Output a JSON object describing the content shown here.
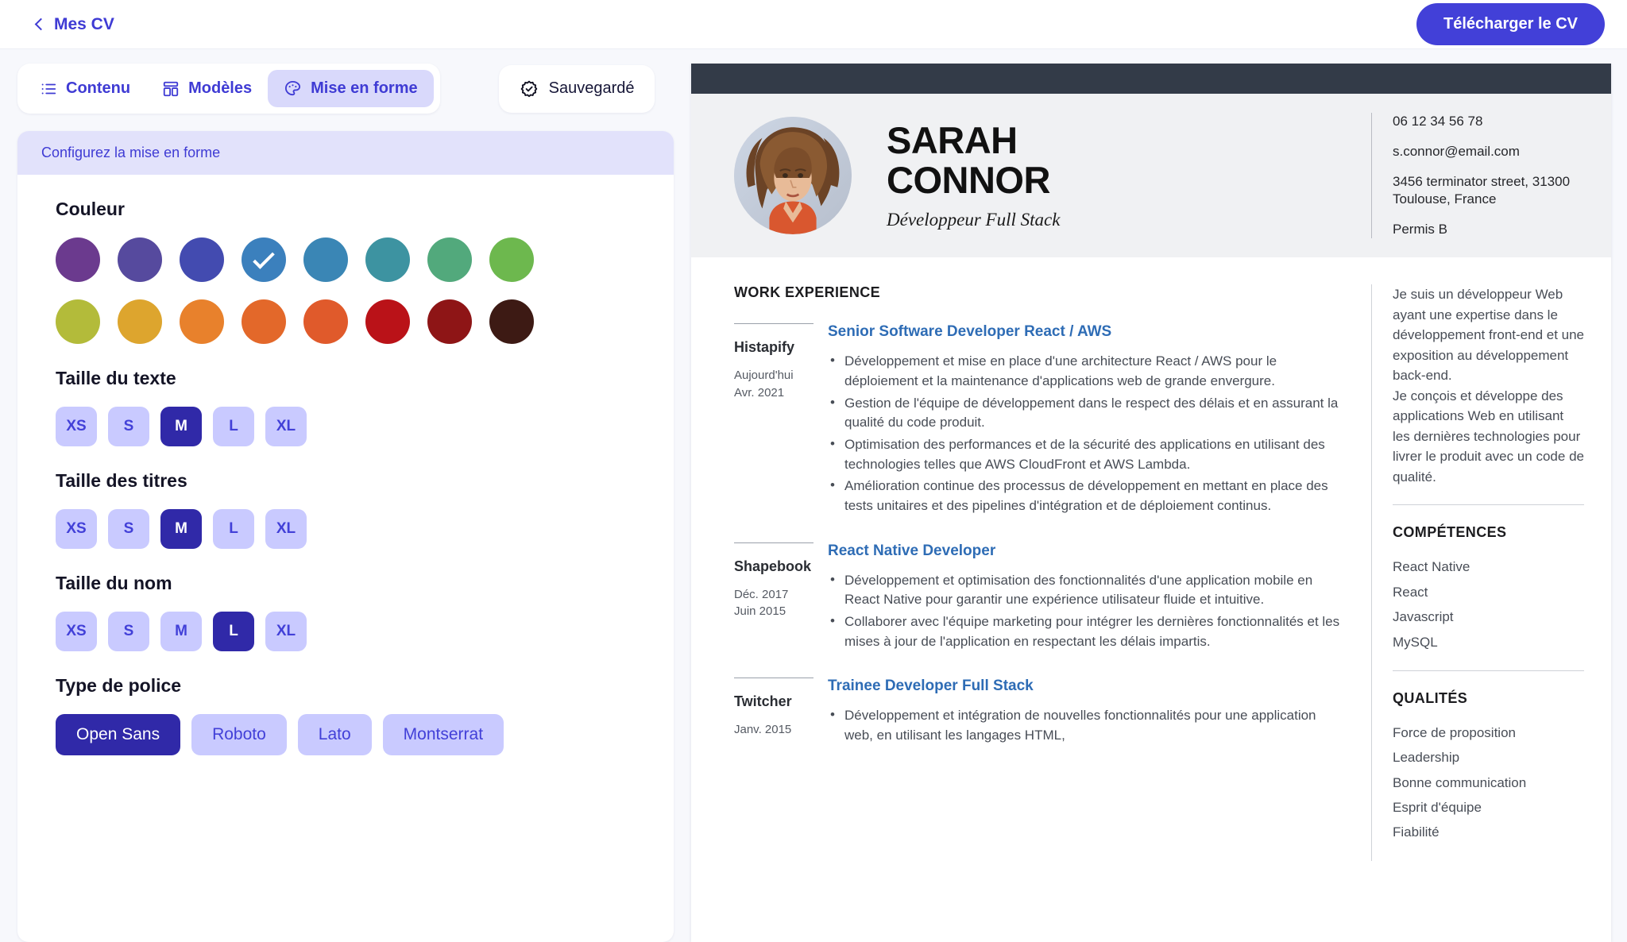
{
  "topbar": {
    "back_label": "Mes CV",
    "back_icon": "chevron-left-icon",
    "download_label": "Télécharger le CV"
  },
  "tabs": [
    {
      "label": "Contenu",
      "icon": "list-icon",
      "active": false
    },
    {
      "label": "Modèles",
      "icon": "layout-icon",
      "active": false
    },
    {
      "label": "Mise en forme",
      "icon": "palette-icon",
      "active": true
    }
  ],
  "save_status": {
    "label": "Sauvegardé",
    "icon": "badge-check-icon"
  },
  "panel": {
    "header": "Configurez la mise en forme",
    "color": {
      "title": "Couleur",
      "selected_index": 3,
      "swatches": [
        "#6b3a8e",
        "#564a9e",
        "#434bb0",
        "#3b80bd",
        "#3a86b5",
        "#3d93a1",
        "#52a97c",
        "#6db84e",
        "#b3bb3a",
        "#dda52e",
        "#e8812c",
        "#e3682a",
        "#e05a2b",
        "#ba1218",
        "#8e1516",
        "#3d1a14"
      ]
    },
    "text_size": {
      "title": "Taille du texte",
      "options": [
        "XS",
        "S",
        "M",
        "L",
        "XL"
      ],
      "selected": "M"
    },
    "heading_size": {
      "title": "Taille des titres",
      "options": [
        "XS",
        "S",
        "M",
        "L",
        "XL"
      ],
      "selected": "M"
    },
    "name_size": {
      "title": "Taille du nom",
      "options": [
        "XS",
        "S",
        "M",
        "L",
        "XL"
      ],
      "selected": "L"
    },
    "font_type": {
      "title": "Type de police",
      "options": [
        "Open Sans",
        "Roboto",
        "Lato",
        "Montserrat"
      ],
      "selected": "Open Sans"
    }
  },
  "cv": {
    "name_line1": "SARAH",
    "name_line2": "CONNOR",
    "role": "Développeur Full Stack",
    "avatar_alt": "profile-photo",
    "contact": [
      "06 12 34 56 78",
      "s.connor@email.com",
      "3456 terminator street, 31300 Toulouse, France",
      "Permis B"
    ],
    "experience_title": "WORK EXPERIENCE",
    "jobs": [
      {
        "company": "Histapify",
        "date_end": "Aujourd'hui",
        "date_start": "Avr. 2021",
        "title": "Senior Software Developer React / AWS",
        "bullets": [
          "Développement et mise en place d'une architecture React / AWS pour le déploiement et la maintenance d'applications web de grande envergure.",
          "Gestion de l'équipe de développement dans le respect des délais et en assurant la qualité du code produit.",
          "Optimisation des performances et de la sécurité des applications en utilisant des technologies telles que AWS CloudFront et AWS Lambda.",
          "Amélioration continue des processus de développement en mettant en place des tests unitaires et des pipelines d'intégration et de déploiement continus."
        ]
      },
      {
        "company": "Shapebook",
        "date_end": "Déc. 2017",
        "date_start": "Juin 2015",
        "title": "React Native Developer",
        "bullets": [
          "Développement et optimisation des fonctionnalités d'une application mobile en React Native pour garantir une expérience utilisateur fluide et intuitive.",
          "Collaborer avec l'équipe marketing pour intégrer les dernières fonctionnalités et les mises à jour de l'application en respectant les délais impartis."
        ]
      },
      {
        "company": "Twitcher",
        "date_end": "Janv. 2015",
        "date_start": "",
        "title": "Trainee Developer Full Stack",
        "bullets": [
          "Développement et intégration de nouvelles fonctionnalités pour une application web, en utilisant les langages HTML,"
        ]
      }
    ],
    "summary": "Je suis un développeur Web ayant une expertise dans le développement front-end et une exposition au développement back-end.\nJe conçois et développe des applications Web en utilisant les dernières technologies pour livrer le produit avec un code de qualité.",
    "skills_title": "COMPÉTENCES",
    "skills": [
      "React Native",
      "React",
      "Javascript",
      "MySQL"
    ],
    "qualities_title": "QUALITÉS",
    "qualities": [
      "Force de proposition",
      "Leadership",
      "Bonne communication",
      "Esprit d'équipe",
      "Fiabilité"
    ]
  }
}
